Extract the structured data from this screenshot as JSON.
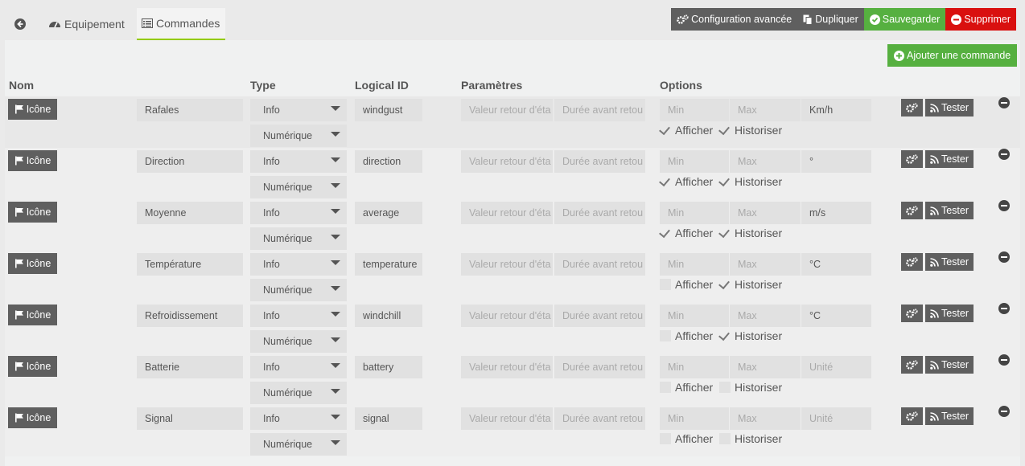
{
  "tabs": {
    "back_icon": "arrow-circle-left-icon",
    "equipement": "Equipement",
    "commandes": "Commandes"
  },
  "actions": {
    "config": "Configuration avancée",
    "duplicate": "Dupliquer",
    "save": "Sauvegarder",
    "delete": "Supprimer"
  },
  "add_command": "Ajouter une commande",
  "headers": {
    "nom": "Nom",
    "type": "Type",
    "logical_id": "Logical ID",
    "parametres": "Paramètres",
    "options": "Options"
  },
  "row_labels": {
    "icon": "Icône",
    "value_placeholder": "Valeur retour d'éta",
    "duration_placeholder": "Durée avant retou",
    "min_placeholder": "Min",
    "max_placeholder": "Max",
    "unit_placeholder": "Unité",
    "show": "Afficher",
    "history": "Historiser",
    "test": "Tester"
  },
  "colors": {
    "accent_green": "#56b040",
    "danger_red": "#d9100f",
    "dark_button": "#5f5f5f",
    "active_tab_underline": "#94ca02"
  },
  "commands": [
    {
      "name": "Rafales",
      "type": "Info",
      "subtype": "Numérique",
      "logical_id": "windgust",
      "unit": "Km/h",
      "show": true,
      "history": true
    },
    {
      "name": "Direction",
      "type": "Info",
      "subtype": "Numérique",
      "logical_id": "direction",
      "unit": "°",
      "show": true,
      "history": true
    },
    {
      "name": "Moyenne",
      "type": "Info",
      "subtype": "Numérique",
      "logical_id": "average",
      "unit": "m/s",
      "show": true,
      "history": true
    },
    {
      "name": "Température",
      "type": "Info",
      "subtype": "Numérique",
      "logical_id": "temperature",
      "unit": "°C",
      "show": false,
      "history": true
    },
    {
      "name": "Refroidissement",
      "type": "Info",
      "subtype": "Numérique",
      "logical_id": "windchill",
      "unit": "°C",
      "show": false,
      "history": true
    },
    {
      "name": "Batterie",
      "type": "Info",
      "subtype": "Numérique",
      "logical_id": "battery",
      "unit": "",
      "show": false,
      "history": false
    },
    {
      "name": "Signal",
      "type": "Info",
      "subtype": "Numérique",
      "logical_id": "signal",
      "unit": "",
      "show": false,
      "history": false
    }
  ]
}
